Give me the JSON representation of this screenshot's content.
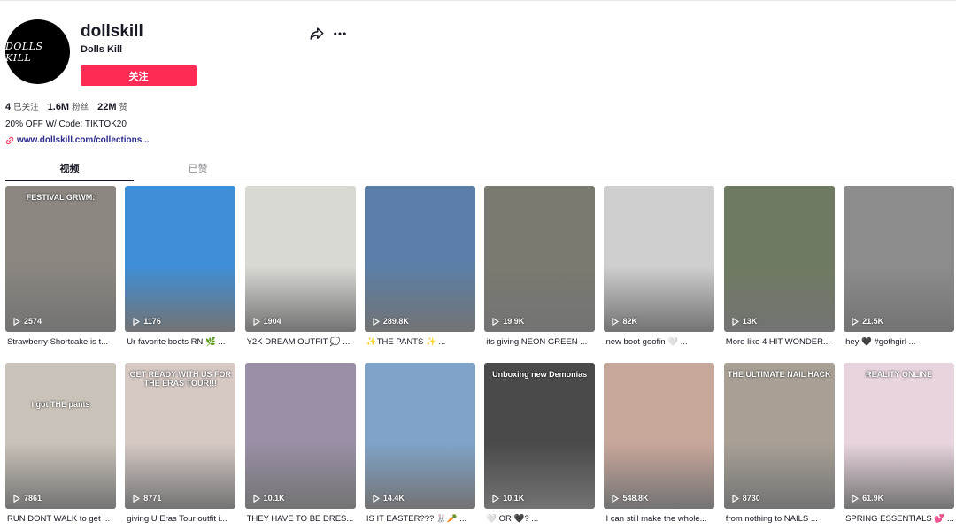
{
  "profile": {
    "avatar_text": "DOLLS KILL",
    "username": "dollskill",
    "nickname": "Dolls Kill",
    "follow_label": "关注",
    "bio": "20% OFF W/ Code: TIKTOK20",
    "link": "www.dollskill.com/collections..."
  },
  "stats": {
    "following_count": "4",
    "following_label": "已关注",
    "followers_count": "1.6M",
    "followers_label": "粉丝",
    "likes_count": "22M",
    "likes_label": "赞"
  },
  "tabs": {
    "videos": "视频",
    "liked": "已赞"
  },
  "videos": [
    {
      "views": "2574",
      "caption": "Strawberry Shortcake is t...",
      "overlay": "FESTIVAL GRWM:",
      "bg": "#8b8680"
    },
    {
      "views": "1176",
      "caption": "Ur favorite boots RN 🌿 ...",
      "overlay": "",
      "bg": "#3f8fd6"
    },
    {
      "views": "1904",
      "caption": "Y2K DREAM OUTFIT 💭 ...",
      "overlay": "",
      "bg": "#d9d9d4"
    },
    {
      "views": "289.8K",
      "caption": "✨THE PANTS ✨ ...",
      "overlay": "",
      "bg": "#5b7fa8"
    },
    {
      "views": "19.9K",
      "caption": "its giving NEON GREEN ...",
      "overlay": "",
      "bg": "#7a7a70"
    },
    {
      "views": "82K",
      "caption": "new boot goofin 🤍 ...",
      "overlay": "",
      "bg": "#cfcfcf"
    },
    {
      "views": "13K",
      "caption": "More like 4 HIT WONDER...",
      "overlay": "",
      "bg": "#6f7a62"
    },
    {
      "views": "21.5K",
      "caption": "hey 🖤 #gothgirl ...",
      "overlay": "",
      "bg": "#8c8c8c"
    },
    {
      "views": "7861",
      "caption": "RUN DONT WALK to get ...",
      "overlay": "i got THE pants",
      "bg": "#c9c2b8"
    },
    {
      "views": "8771",
      "caption": "giving U Eras Tour outfit i...",
      "overlay": "GET READY WITH US FOR THE ERAS TOUR!!!",
      "bg": "#d6c9c4"
    },
    {
      "views": "10.1K",
      "caption": "THEY HAVE TO BE DRES...",
      "overlay": "",
      "bg": "#9a8fa6"
    },
    {
      "views": "14.4K",
      "caption": "IS IT EASTER??? 🐰🥕 ...",
      "overlay": "",
      "bg": "#7fa3c9"
    },
    {
      "views": "10.1K",
      "caption": "🤍 OR 🖤? ...",
      "overlay": "Unboxing new Demonias",
      "bg": "#4a4a4a"
    },
    {
      "views": "548.8K",
      "caption": "I can still make the whole...",
      "overlay": "",
      "bg": "#c8a79b"
    },
    {
      "views": "8730",
      "caption": "from nothing to NAILS ...",
      "overlay": "THE ULTIMATE NAIL HACK",
      "bg": "#a8a095"
    },
    {
      "views": "61.9K",
      "caption": "SPRING ESSENTIALS 💕 ...",
      "overlay": "REALITY    ONLINE",
      "bg": "#e8d4df"
    }
  ]
}
